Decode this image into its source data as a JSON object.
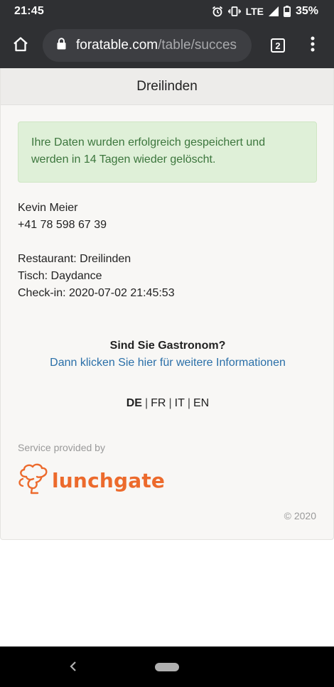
{
  "status_bar": {
    "time": "21:45",
    "network": "LTE",
    "battery": "35%"
  },
  "browser": {
    "url_domain": "foratable.com",
    "url_path": "/table/succes",
    "tab_count": "2"
  },
  "page": {
    "header_title": "Dreilinden",
    "success_message": "Ihre Daten wurden erfolgreich gespeichert und werden in 14 Tagen wieder gelöscht.",
    "person": {
      "name": "Kevin Meier",
      "phone": "+41 78 598 67 39"
    },
    "booking": {
      "restaurant": "Restaurant: Dreilinden",
      "table": "Tisch: Daydance",
      "checkin": "Check-in: 2020-07-02 21:45:53"
    },
    "gastro": {
      "title": "Sind Sie Gastronom?",
      "link": "Dann klicken Sie hier für weitere Informationen"
    },
    "languages": [
      "DE",
      "FR",
      "IT",
      "EN"
    ],
    "active_language": "DE",
    "footer": {
      "service_text": "Service provided by",
      "logo_text": "lunchgate",
      "copyright": "© 2020"
    }
  },
  "colors": {
    "alert_bg": "#dff0d8",
    "alert_text": "#3c763d",
    "link": "#2a6fa8",
    "brand": "#ec6a2c"
  },
  "icons": [
    "alarm-icon",
    "vibrate-icon",
    "signal-icon",
    "battery-icon",
    "home-icon",
    "lock-icon",
    "tabs-icon",
    "more-vert-icon",
    "back-icon"
  ]
}
